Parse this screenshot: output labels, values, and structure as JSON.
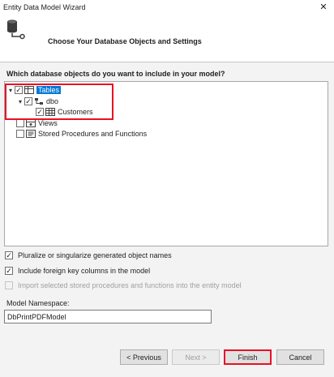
{
  "window": {
    "title": "Entity Data Model Wizard",
    "close_glyph": "✕"
  },
  "header": {
    "title": "Choose Your Database Objects and Settings",
    "icon": "database-connect-icon"
  },
  "question": "Which database objects do you want to include in your model?",
  "tree": {
    "tables": {
      "label": "Tables",
      "checked": true,
      "expanded": true,
      "selected": true
    },
    "dbo": {
      "label": "dbo",
      "checked": true,
      "expanded": true
    },
    "customers": {
      "label": "Customers",
      "checked": true
    },
    "views": {
      "label": "Views",
      "checked": false
    },
    "procs": {
      "label": "Stored Procedures and Functions",
      "checked": false
    }
  },
  "options": {
    "pluralize": {
      "label": "Pluralize or singularize generated object names",
      "checked": true
    },
    "foreign_keys": {
      "label": "Include foreign key columns in the model",
      "checked": true
    },
    "import_procs": {
      "label": "Import selected stored procedures and functions into the entity model",
      "checked": false,
      "disabled": true
    }
  },
  "namespace": {
    "label": "Model Namespace:",
    "value": "DbPrintPDFModel"
  },
  "buttons": {
    "previous": "< Previous",
    "next": "Next >",
    "finish": "Finish",
    "cancel": "Cancel"
  },
  "colors": {
    "highlight": "#e81123",
    "selection": "#0078d7"
  }
}
